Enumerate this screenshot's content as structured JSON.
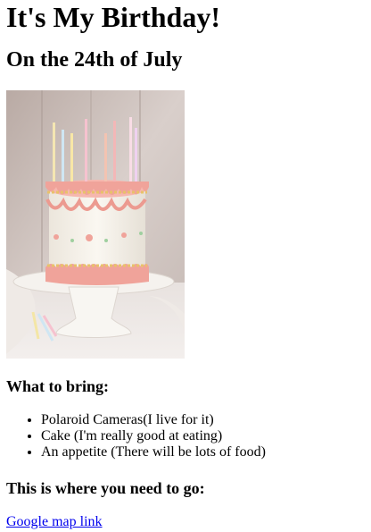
{
  "heading": "It's My Birthday!",
  "subheading": "On the 24th of July",
  "image": {
    "icon": "birthday-cake-photo"
  },
  "bring": {
    "title": "What to bring:",
    "items": [
      "Polaroid Cameras(I live for it)",
      "Cake (I'm really good at eating)",
      "An appetite (There will be lots of food)"
    ]
  },
  "location": {
    "title": "This is where you need to go:",
    "link_text": "Google map link"
  },
  "colors": {
    "link": "#0000EE",
    "frosting_pink": "#f0a39a",
    "cake_white": "#f7f3ec"
  }
}
